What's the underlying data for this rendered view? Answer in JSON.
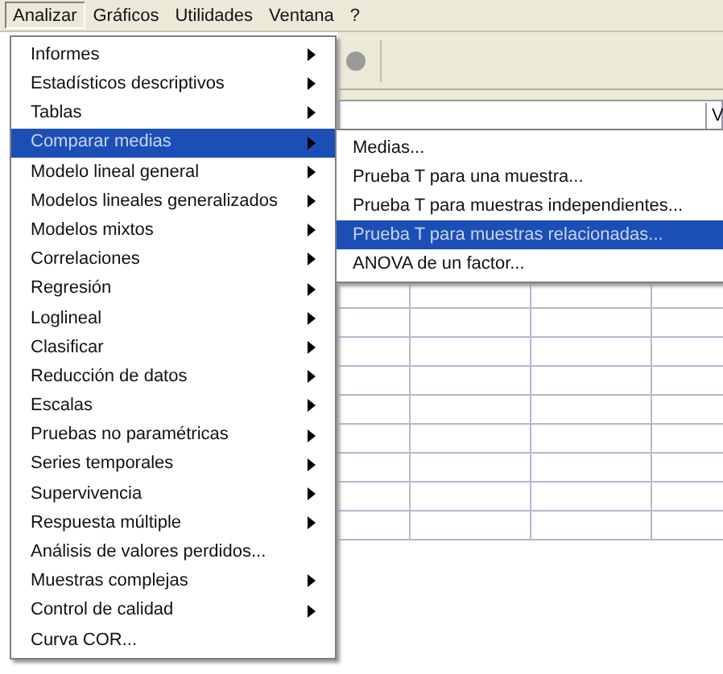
{
  "menu_bar": [
    {
      "label": "Analizar",
      "selected": true
    },
    {
      "label": "Gráficos",
      "selected": false
    },
    {
      "label": "Utilidades",
      "selected": false
    },
    {
      "label": "Ventana",
      "selected": false
    },
    {
      "label": "?",
      "selected": false
    }
  ],
  "column_header_fragment": "V",
  "analyze_menu": [
    {
      "label": "Informes",
      "kind": "submenu",
      "selected": false
    },
    {
      "label": "Estadísticos descriptivos",
      "kind": "submenu",
      "selected": false
    },
    {
      "label": "Tablas",
      "kind": "submenu",
      "selected": false
    },
    {
      "label": "Comparar medias",
      "kind": "submenu",
      "selected": true
    },
    {
      "label": "Modelo lineal general",
      "kind": "submenu",
      "selected": false
    },
    {
      "label": "Modelos lineales generalizados",
      "kind": "submenu",
      "selected": false
    },
    {
      "label": "Modelos mixtos",
      "kind": "submenu",
      "selected": false
    },
    {
      "label": "Correlaciones",
      "kind": "submenu",
      "selected": false
    },
    {
      "label": "Regresión",
      "kind": "submenu",
      "selected": false
    },
    {
      "label": "Loglineal",
      "kind": "submenu",
      "selected": false
    },
    {
      "label": "Clasificar",
      "kind": "submenu",
      "selected": false
    },
    {
      "label": "Reducción de datos",
      "kind": "submenu",
      "selected": false
    },
    {
      "label": "Escalas",
      "kind": "submenu",
      "selected": false
    },
    {
      "label": "Pruebas no paramétricas",
      "kind": "submenu",
      "selected": false
    },
    {
      "label": "Series temporales",
      "kind": "submenu",
      "selected": false
    },
    {
      "label": "Supervivencia",
      "kind": "submenu",
      "selected": false
    },
    {
      "label": "Respuesta múltiple",
      "kind": "submenu",
      "selected": false
    },
    {
      "label": "Análisis de valores perdidos...",
      "kind": "command",
      "selected": false
    },
    {
      "label": "Muestras complejas",
      "kind": "submenu",
      "selected": false
    },
    {
      "label": "Control de calidad",
      "kind": "submenu",
      "selected": false
    },
    {
      "label": "Curva COR...",
      "kind": "command",
      "selected": false
    }
  ],
  "compare_means_submenu": [
    {
      "label": "Medias...",
      "selected": false
    },
    {
      "label": "Prueba T para una muestra...",
      "selected": false
    },
    {
      "label": "Prueba T para muestras independientes...",
      "selected": false
    },
    {
      "label": "Prueba T para muestras relacionadas...",
      "selected": true
    },
    {
      "label": "ANOVA de un factor...",
      "selected": false
    }
  ]
}
